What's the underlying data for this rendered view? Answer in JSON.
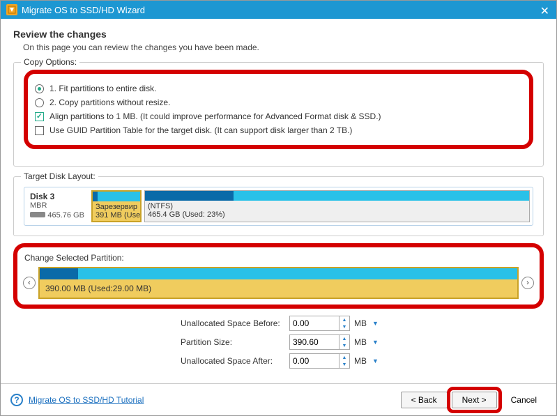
{
  "titlebar": {
    "title": "Migrate OS to SSD/HD Wizard"
  },
  "heading": "Review the changes",
  "subheading": "On this page you can review the changes you have been made.",
  "copy_options": {
    "legend": "Copy Options:",
    "opt1": "1. Fit partitions to entire disk.",
    "opt2": "2. Copy partitions without resize.",
    "align": "Align partitions to 1 MB.  (It could improve performance for Advanced Format disk & SSD.)",
    "guid": "Use GUID Partition Table for the target disk. (It can support disk larger than 2 TB.)"
  },
  "target_layout": {
    "legend": "Target Disk Layout:",
    "disk_name": "Disk 3",
    "disk_type": "MBR",
    "disk_size": "465.76 GB",
    "part1_name": "Зарезервир",
    "part1_size": "391 MB (Use",
    "part2_name": "(NTFS)",
    "part2_size": "465.4 GB (Used: 23%)"
  },
  "change_partition": {
    "legend": "Change Selected Partition:",
    "label": "390.00 MB (Used:29.00 MB)"
  },
  "form": {
    "before_label": "Unallocated Space Before:",
    "before_value": "0.00",
    "size_label": "Partition Size:",
    "size_value": "390.60",
    "after_label": "Unallocated Space After:",
    "after_value": "0.00",
    "unit": "MB"
  },
  "footer": {
    "tutorial": "Migrate OS to SSD/HD Tutorial",
    "back": "< Back",
    "next": "Next >",
    "cancel": "Cancel"
  }
}
